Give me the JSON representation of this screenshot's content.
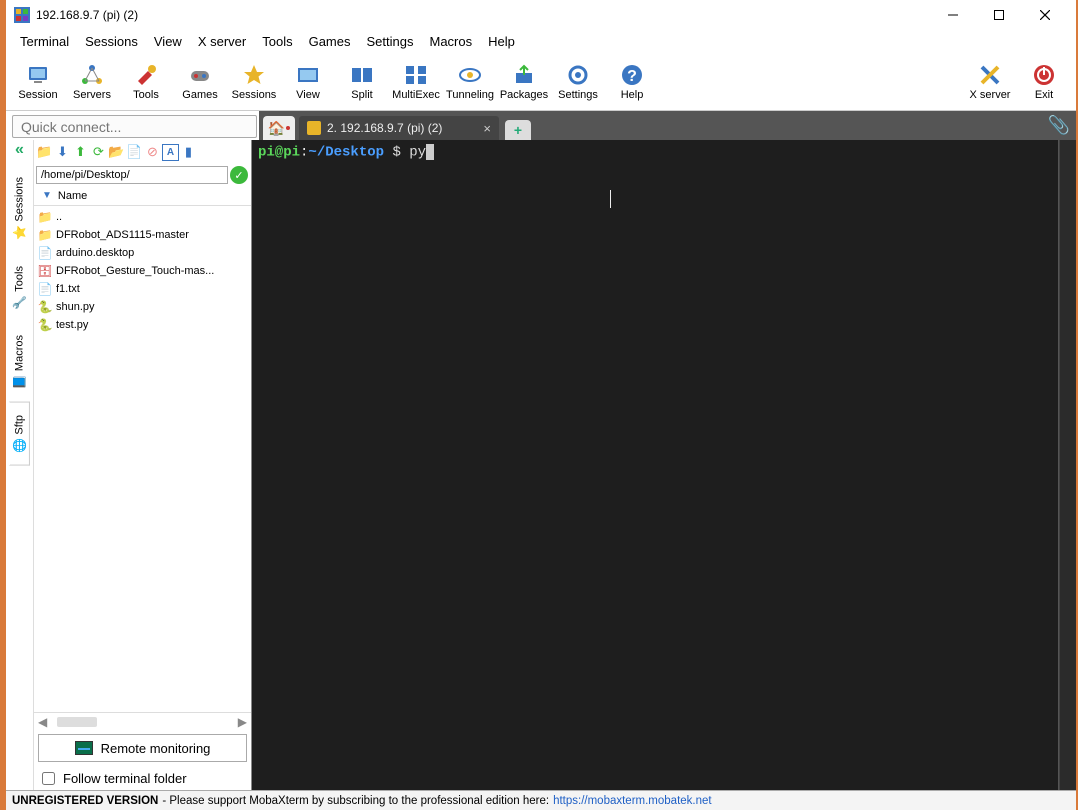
{
  "window": {
    "title": "192.168.9.7 (pi) (2)"
  },
  "menu": [
    "Terminal",
    "Sessions",
    "View",
    "X server",
    "Tools",
    "Games",
    "Settings",
    "Macros",
    "Help"
  ],
  "toolbar": [
    {
      "label": "Session",
      "icon": "session"
    },
    {
      "label": "Servers",
      "icon": "servers"
    },
    {
      "label": "Tools",
      "icon": "tools"
    },
    {
      "label": "Games",
      "icon": "games"
    },
    {
      "label": "Sessions",
      "icon": "sessions"
    },
    {
      "label": "View",
      "icon": "view"
    },
    {
      "label": "Split",
      "icon": "split"
    },
    {
      "label": "MultiExec",
      "icon": "multiexec"
    },
    {
      "label": "Tunneling",
      "icon": "tunneling"
    },
    {
      "label": "Packages",
      "icon": "packages"
    },
    {
      "label": "Settings",
      "icon": "settings"
    },
    {
      "label": "Help",
      "icon": "help"
    }
  ],
  "toolbar_right": [
    {
      "label": "X server",
      "icon": "xserver"
    },
    {
      "label": "Exit",
      "icon": "exit"
    }
  ],
  "quick_connect_placeholder": "Quick connect...",
  "tabs": {
    "active": {
      "label": "2. 192.168.9.7 (pi) (2)"
    }
  },
  "side_tabs": [
    "Sessions",
    "Tools",
    "Macros",
    "Sftp"
  ],
  "sftp": {
    "path": "/home/pi/Desktop/",
    "header": "Name",
    "files": [
      {
        "name": "..",
        "type": "up"
      },
      {
        "name": "DFRobot_ADS1115-master",
        "type": "folder"
      },
      {
        "name": "arduino.desktop",
        "type": "file"
      },
      {
        "name": "DFRobot_Gesture_Touch-mas...",
        "type": "archive"
      },
      {
        "name": "f1.txt",
        "type": "txt"
      },
      {
        "name": "shun.py",
        "type": "py"
      },
      {
        "name": "test.py",
        "type": "py"
      }
    ],
    "remote_monitoring": "Remote monitoring",
    "follow": "Follow terminal folder"
  },
  "terminal": {
    "prompt_user": "pi@pi",
    "prompt_sep": ":",
    "prompt_path": "~/Desktop",
    "prompt_dollar": " $ ",
    "command": "py"
  },
  "status": {
    "unregistered": "UNREGISTERED VERSION",
    "message": "  -  Please support MobaXterm by subscribing to the professional edition here:  ",
    "link": "https://mobaxterm.mobatek.net"
  }
}
